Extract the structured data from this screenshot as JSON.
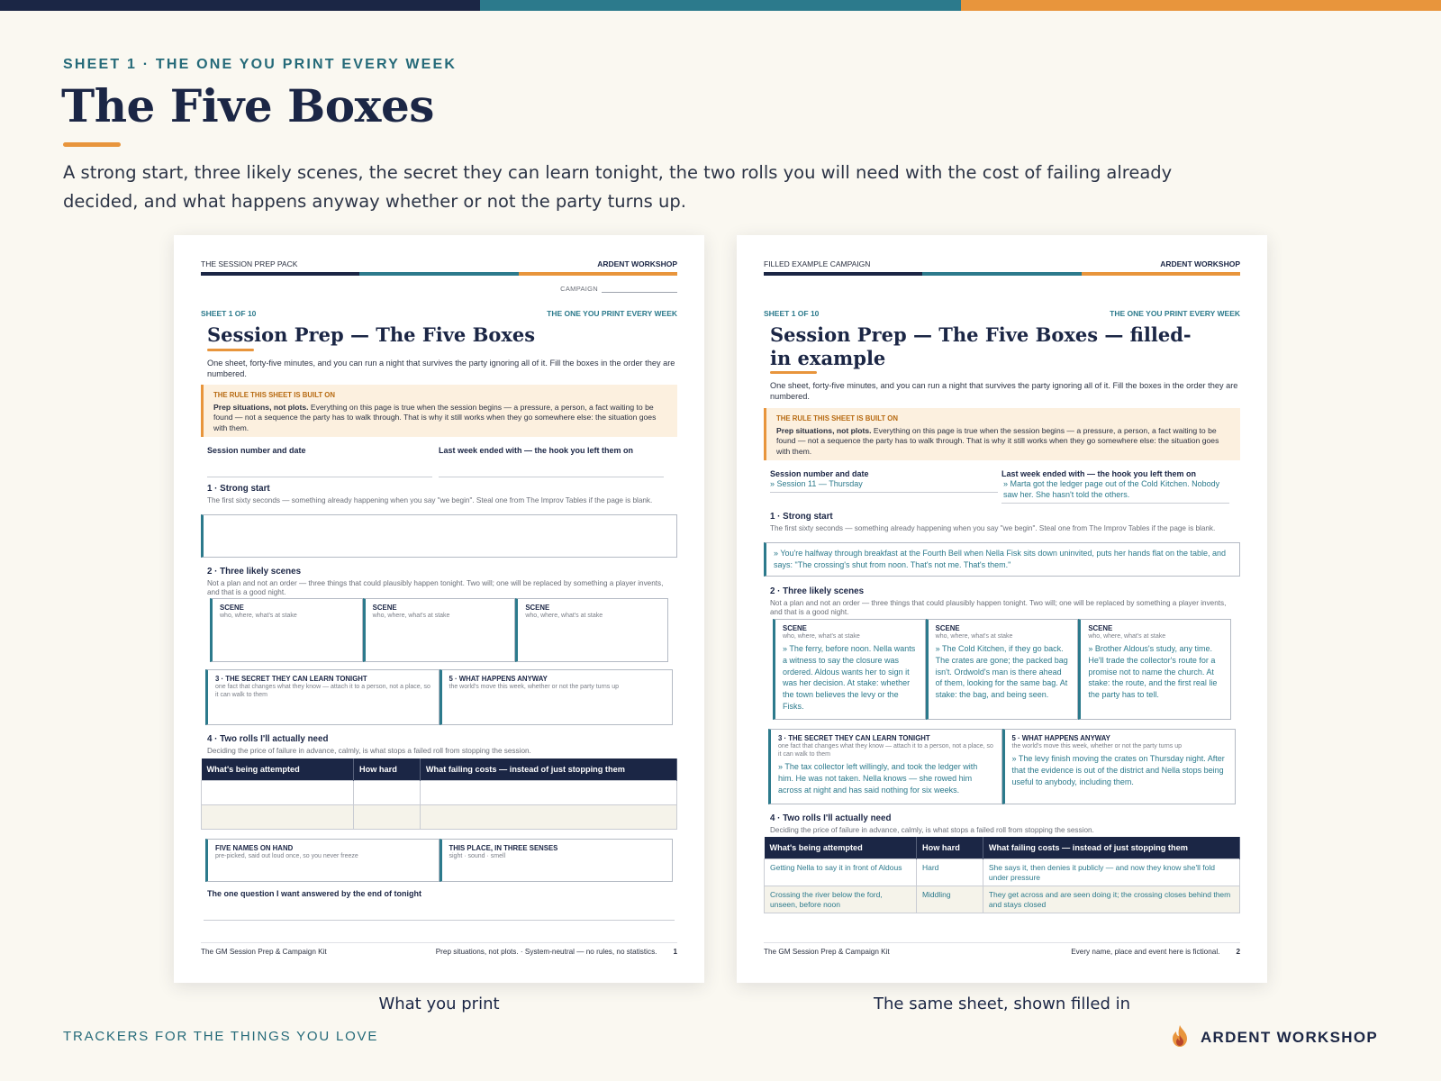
{
  "colors": {
    "navy": "#1b2645",
    "teal": "#2c7a8c",
    "orange": "#e8953c",
    "background": "#faf8f1"
  },
  "page": {
    "eyebrow": "SHEET 1 · THE ONE YOU PRINT EVERY WEEK",
    "title": "The Five Boxes",
    "description": "A strong start, three likely scenes, the secret they can learn tonight, the two rolls you will need with the cost of failing already decided, and what happens anyway whether or not the party turns up."
  },
  "left_sheet": {
    "header_left": "THE SESSION PREP PACK",
    "header_right": "ARDENT WORKSHOP",
    "campaign_label": "CAMPAIGN",
    "sheet_number": "SHEET 1 OF 10",
    "sheet_tag": "THE ONE YOU PRINT EVERY WEEK",
    "title": "Session Prep — The Five Boxes",
    "intro": "One sheet, forty-five minutes, and you can run a night that survives the party ignoring all of it. Fill the boxes in the order they are numbered.",
    "rule_heading": "THE RULE THIS SHEET IS BUILT ON",
    "rule_bold": "Prep situations, not plots.",
    "rule_text": " Everything on this page is true when the session begins — a pressure, a person, a fact waiting to be found — not a sequence the party has to walk through. That is why it still works when they go somewhere else: the situation goes with them.",
    "field_session": "Session number and date",
    "field_lastweek": "Last week ended with — the hook you left them on",
    "strong_start_title": "1 · Strong start",
    "strong_start_desc": "The first sixty seconds — something already happening when you say \"we begin\". Steal one from The Improv Tables if the page is blank.",
    "scenes_title": "2 · Three likely scenes",
    "scenes_desc": "Not a plan and not an order — three things that could plausibly happen tonight. Two will; one will be replaced by something a player invents, and that is a good night.",
    "scene_label": "SCENE",
    "scene_sub": "who, where, what's at stake",
    "secret_title": "3 · THE SECRET THEY CAN LEARN TONIGHT",
    "secret_sub": "one fact that changes what they know — attach it to a person, not a place, so it can walk to them",
    "anyway_title": "5 · WHAT HAPPENS ANYWAY",
    "anyway_sub": "the world's move this week, whether or not the party turns up",
    "rolls_title": "4 · Two rolls I'll actually need",
    "rolls_desc": "Deciding the price of failure in advance, calmly, is what stops a failed roll from stopping the session.",
    "col_attempt": "What's being attempted",
    "col_hard": "How hard",
    "col_cost": "What failing costs — instead of just stopping them",
    "names_title": "FIVE NAMES ON HAND",
    "names_sub": "pre-picked, said out loud once, so you never freeze",
    "senses_title": "THIS PLACE, IN THREE SENSES",
    "senses_sub": "sight · sound · smell",
    "question": "The one question I want answered by the end of tonight",
    "footer_left": "The GM Session Prep & Campaign Kit",
    "footer_right": "Prep situations, not plots.  ·  System-neutral — no rules, no statistics.",
    "page_number": "1"
  },
  "right_sheet": {
    "header_left": "FILLED EXAMPLE CAMPAIGN",
    "header_right": "ARDENT WORKSHOP",
    "sheet_number": "SHEET 1 OF 10",
    "sheet_tag": "THE ONE YOU PRINT EVERY WEEK",
    "title": "Session Prep — The Five Boxes — filled-in example",
    "intro": "One sheet, forty-five minutes, and you can run a night that survives the party ignoring all of it. Fill the boxes in the order they are numbered.",
    "rule_heading": "THE RULE THIS SHEET IS BUILT ON",
    "rule_bold": "Prep situations, not plots.",
    "rule_text": " Everything on this page is true when the session begins — a pressure, a person, a fact waiting to be found — not a sequence the party has to walk through. That is why it still works when they go somewhere else: the situation goes with them.",
    "field_session": "Session number and date",
    "field_session_value": "» Session 11 — Thursday",
    "field_lastweek": "Last week ended with — the hook you left them on",
    "field_lastweek_value": "» Marta got the ledger page out of the Cold Kitchen. Nobody saw her. She hasn't told the others.",
    "strong_start_title": "1 · Strong start",
    "strong_start_desc": "The first sixty seconds — something already happening when you say \"we begin\". Steal one from The Improv Tables if the page is blank.",
    "strong_start_value": "» You're halfway through breakfast at the Fourth Bell when Nella Fisk sits down uninvited, puts her hands flat on the table, and says: \"The crossing's shut from noon. That's not me. That's them.\"",
    "scenes_title": "2 · Three likely scenes",
    "scenes_desc": "Not a plan and not an order — three things that could plausibly happen tonight. Two will; one will be replaced by something a player invents, and that is a good night.",
    "scene_label": "SCENE",
    "scene_sub": "who, where, what's at stake",
    "scenes": [
      "» The ferry, before noon. Nella wants a witness to say the closure was ordered. Aldous wants her to sign it was her decision. At stake: whether the town believes the levy or the Fisks.",
      "» The Cold Kitchen, if they go back. The crates are gone; the packed bag isn't. Ordwold's man is there ahead of them, looking for the same bag. At stake: the bag, and being seen.",
      "» Brother Aldous's study, any time. He'll trade the collector's route for a promise not to name the church. At stake: the route, and the first real lie the party has to tell."
    ],
    "secret_title": "3 · THE SECRET THEY CAN LEARN TONIGHT",
    "secret_sub": "one fact that changes what they know — attach it to a person, not a place, so it can walk to them",
    "secret_value": "» The tax collector left willingly, and took the ledger with him. He was not taken. Nella knows — she rowed him across at night and has said nothing for six weeks.",
    "anyway_title": "5 · WHAT HAPPENS ANYWAY",
    "anyway_sub": "the world's move this week, whether or not the party turns up",
    "anyway_value": "» The levy finish moving the crates on Thursday night. After that the evidence is out of the district and Nella stops being useful to anybody, including them.",
    "rolls_title": "4 · Two rolls I'll actually need",
    "rolls_desc": "Deciding the price of failure in advance, calmly, is what stops a failed roll from stopping the session.",
    "col_attempt": "What's being attempted",
    "col_hard": "How hard",
    "col_cost": "What failing costs — instead of just stopping them",
    "rolls": [
      {
        "attempt": "Getting Nella to say it in front of Aldous",
        "hard": "Hard",
        "cost": "She says it, then denies it publicly — and now they know she'll fold under pressure"
      },
      {
        "attempt": "Crossing the river below the ford, unseen, before noon",
        "hard": "Middling",
        "cost": "They get across and are seen doing it; the crossing closes behind them and stays closed"
      }
    ],
    "footer_left": "The GM Session Prep & Campaign Kit",
    "footer_right": "Every name, place and event here is fictional.",
    "page_number": "2"
  },
  "captions": {
    "left": "What you print",
    "right": "The same sheet, shown filled in"
  },
  "footer": {
    "tagline": "TRACKERS FOR THE THINGS YOU LOVE",
    "brand": "ARDENT WORKSHOP",
    "brand_icon": "flame-icon"
  }
}
